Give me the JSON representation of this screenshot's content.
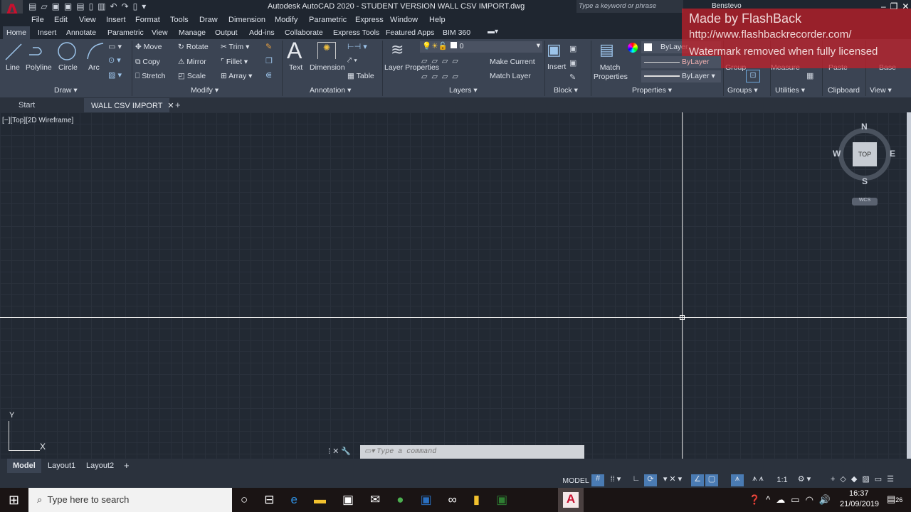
{
  "title": "Autodesk AutoCAD 2020 - STUDENT VERSION    WALL CSV IMPORT.dwg",
  "search_placeholder": "Type a keyword or phrase",
  "user": "Benstevo",
  "menu": [
    "File",
    "Edit",
    "View",
    "Insert",
    "Format",
    "Tools",
    "Draw",
    "Dimension",
    "Modify",
    "Parametric",
    "Express",
    "Window",
    "Help"
  ],
  "ribbon_tabs": [
    "Home",
    "Insert",
    "Annotate",
    "Parametric",
    "View",
    "Manage",
    "Output",
    "Add-ins",
    "Collaborate",
    "Express Tools",
    "Featured Apps",
    "BIM 360"
  ],
  "draw": {
    "label": "Draw",
    "line": "Line",
    "polyline": "Polyline",
    "circle": "Circle",
    "arc": "Arc"
  },
  "modify": {
    "label": "Modify",
    "move": "Move",
    "rotate": "Rotate",
    "trim": "Trim",
    "copy": "Copy",
    "mirror": "Mirror",
    "fillet": "Fillet",
    "stretch": "Stretch",
    "scale": "Scale",
    "array": "Array"
  },
  "annotation": {
    "label": "Annotation",
    "text": "Text",
    "dimension": "Dimension",
    "table": "Table"
  },
  "layers": {
    "label": "Layers",
    "layer_properties": "Layer Properties",
    "current_layer": "0",
    "make_current": "Make Current",
    "match_layer": "Match Layer"
  },
  "block": {
    "label": "Block",
    "insert": "Insert"
  },
  "properties": {
    "label": "Properties",
    "match": "Match Properties",
    "color": "ByLayer",
    "linetype": "ByLayer",
    "lineweight": "ByLayer"
  },
  "groups": {
    "label": "Groups",
    "group": "Group"
  },
  "utilities": {
    "label": "Utilities",
    "measure": "Measure"
  },
  "clipboard": {
    "label": "Clipboard",
    "paste": "Paste"
  },
  "view": {
    "label": "View",
    "base": "Base"
  },
  "watermark": {
    "line1": "Made by FlashBack",
    "line2": "http://www.flashbackrecorder.com/",
    "line3": "Watermark removed when fully licensed"
  },
  "file_tabs": [
    "Start",
    "WALL CSV IMPORT"
  ],
  "viewport_label": "[−][Top][2D Wireframe]",
  "viewcube": {
    "n": "N",
    "s": "S",
    "e": "E",
    "w": "W",
    "top": "TOP",
    "wcs": "WCS"
  },
  "ucs": {
    "x": "X",
    "y": "Y"
  },
  "command_placeholder": "Type a command",
  "layout_tabs": [
    "Model",
    "Layout1",
    "Layout2"
  ],
  "status": {
    "model": "MODEL",
    "scale": "1:1"
  },
  "taskbar": {
    "search": "Type here to search",
    "time": "16:37",
    "date": "21/09/2019",
    "notifications": "26"
  },
  "colors": {
    "accent": "#4a7bb3",
    "canvas": "#222933",
    "ribbon": "#3b4453",
    "watermark": "#c81e28"
  }
}
